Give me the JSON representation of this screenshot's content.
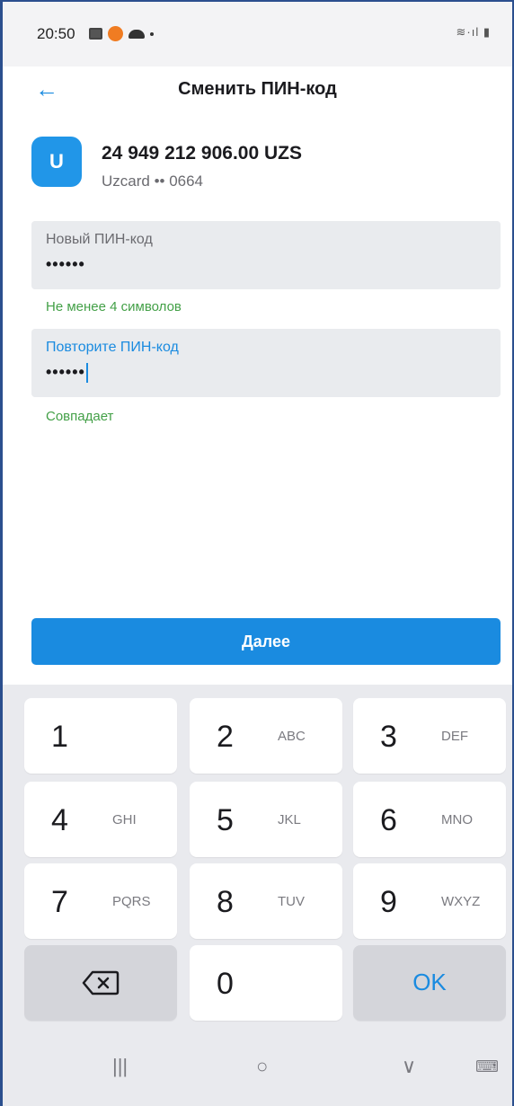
{
  "status_bar": {
    "time": "20:50",
    "right_icons": "≋·ıl ▮"
  },
  "header": {
    "back_icon": "arrow-left-icon",
    "title": "Сменить ПИН-код"
  },
  "card": {
    "logo_text": "U",
    "amount": "24 949 212 906.00 UZS",
    "meta": "Uzcard •• 0664",
    "accent_color": "#2196e8"
  },
  "form": {
    "new_pin": {
      "label": "Новый ПИН-код",
      "value": "••••••",
      "hint": "Не менее 4 символов"
    },
    "repeat_pin": {
      "label": "Повторите ПИН-код",
      "value": "••••••",
      "hint": "Совпадает"
    }
  },
  "next_button": {
    "label": "Далее",
    "color": "#1a8be0"
  },
  "keypad": {
    "keys": [
      {
        "num": "1",
        "letters": ""
      },
      {
        "num": "2",
        "letters": "ABC"
      },
      {
        "num": "3",
        "letters": "DEF"
      },
      {
        "num": "4",
        "letters": "GHI"
      },
      {
        "num": "5",
        "letters": "JKL"
      },
      {
        "num": "6",
        "letters": "MNO"
      },
      {
        "num": "7",
        "letters": "PQRS"
      },
      {
        "num": "8",
        "letters": "TUV"
      },
      {
        "num": "9",
        "letters": "WXYZ"
      }
    ],
    "zero": "0",
    "ok": "OK",
    "backspace_icon": "backspace-icon"
  },
  "nav_bar": {
    "recents": "|||",
    "home": "○",
    "back": "∨",
    "keyboard": "⌨"
  },
  "colors": {
    "success": "#43a047",
    "accent": "#1a8be0"
  }
}
